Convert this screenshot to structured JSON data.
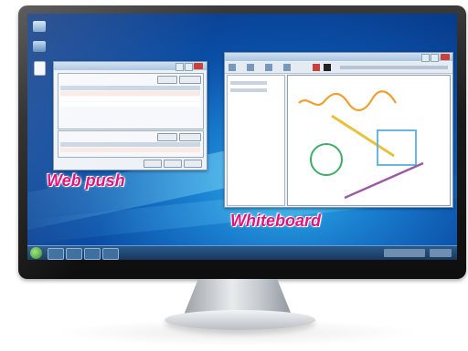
{
  "labels": {
    "web_push": "Web push",
    "whiteboard": "Whiteboard"
  },
  "colors": {
    "label_text": "#e0137f",
    "wallpaper": "#0b4fa8",
    "stroke_orange": "#f0a030",
    "stroke_green": "#3cae6a",
    "stroke_blue": "#5aaee0",
    "stroke_purple": "#9a5aa6",
    "stroke_yellow": "#e8c23a"
  },
  "icons": {
    "desktop": [
      "computer-icon",
      "network-icon",
      "document-icon"
    ],
    "start": "windows-start-icon"
  }
}
